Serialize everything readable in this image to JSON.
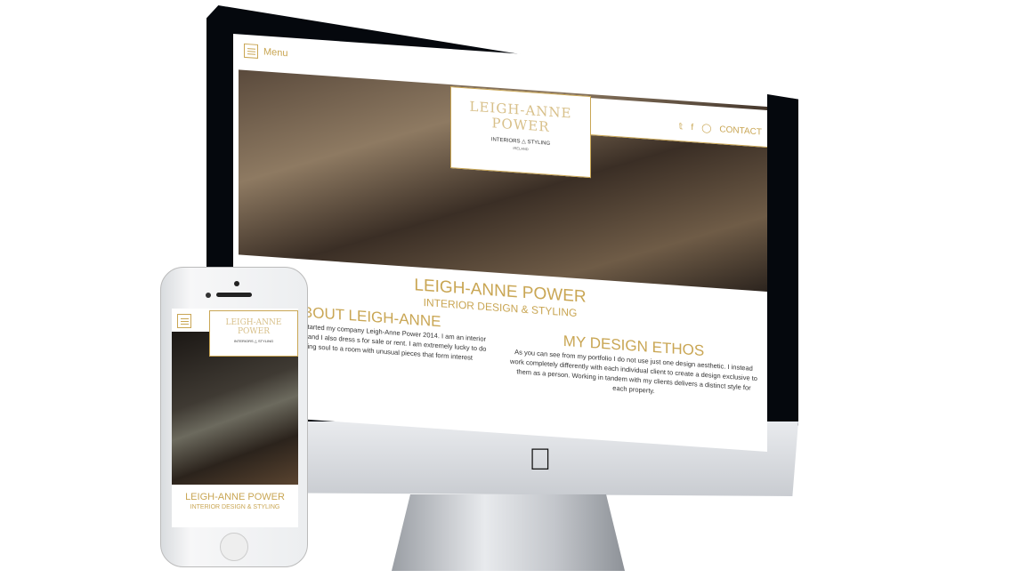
{
  "site": {
    "menu_label": "Menu",
    "logo_name": "LEIGH-ANNE POWER",
    "logo_sub": "INTERIORS △ STYLING",
    "logo_country": "IRELAND",
    "contact_label": "CONTACT",
    "social_icons": [
      "twitter-icon",
      "facebook-icon",
      "instagram-icon"
    ],
    "title": "LEIGH-ANNE POWER",
    "subtitle": "INTERIOR DESIGN & STYLING",
    "about_heading": "ABOUT LEIGH-ANNE",
    "about_text": "ublin, Ireland and I started my company Leigh-Anne Power 2014. I am an interior designer and stylist, and I also dress s for sale or rent. I am extremely lucky to do what I love. I dding soul to a room with unusual pieces that form interest",
    "ethos_heading": "MY DESIGN ETHOS",
    "ethos_text": "As you can see from my portfolio I do not use just one design aesthetic. I instead work completely differently with each individual client to create a design exclusive to them as a person. Working in tandem with my clients delivers a distinct style for each property."
  },
  "colors": {
    "accent": "#c9a654",
    "bezel": "#05080d"
  }
}
